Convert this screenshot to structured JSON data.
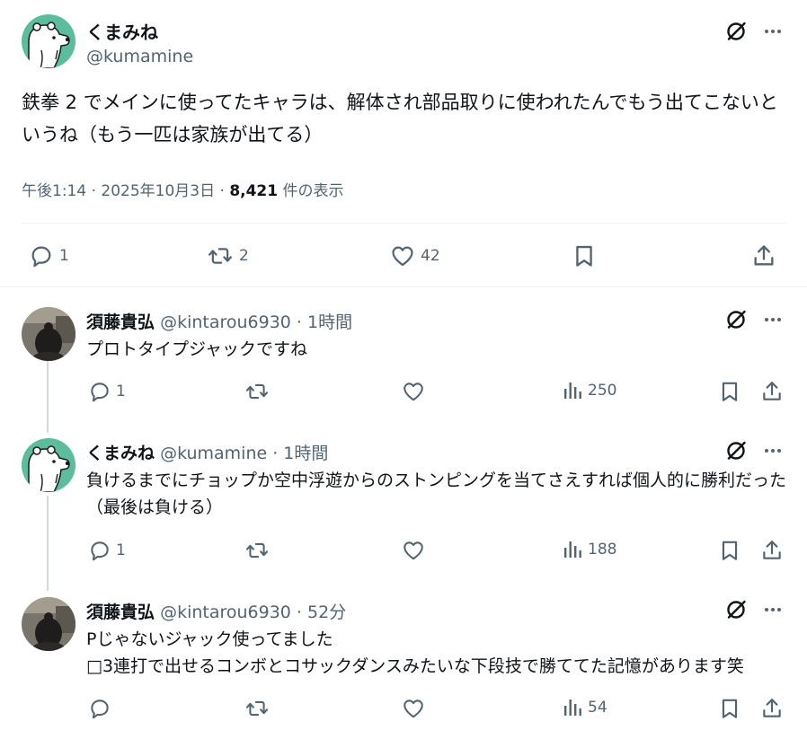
{
  "main_tweet": {
    "author_name": "くまみね",
    "author_handle": "@kumamine",
    "text_line1": "鉄拳 2 でメインに使ってたキャラは、解体され部品取りに使われたんでもう出てこないと",
    "text_line2": "いうね（もう一匹は家族が出てる）",
    "time": "午後1:14 · 2025年10月3日 · ",
    "views_count": "8,421",
    "views_label": " 件の表示",
    "reply_count": "1",
    "retweet_count": "2",
    "like_count": "42"
  },
  "replies": [
    {
      "author_name": "須藤貴弘",
      "author_handle": "@kintarou6930 · 1時間",
      "line1": "プロトタイプジャックですね",
      "line2": "",
      "reply_count": "1",
      "views": "250"
    },
    {
      "author_name": "くまみね",
      "author_handle": "@kumamine · 1時間",
      "line1": "負けるまでにチョップか空中浮遊からのストンピングを当てさえすれば個人的に勝利だった...",
      "line2": "（最後は負ける）",
      "reply_count": "1",
      "views": "188"
    },
    {
      "author_name": "須藤貴弘",
      "author_handle": "@kintarou6930 · 52分",
      "line1": "Pじゃないジャック使ってました",
      "line2": "□3連打で出せるコンボとコサックダンスみたいな下段技で勝ててた記憶があります笑",
      "reply_count": "",
      "views": "54"
    }
  ],
  "icons": {
    "grok": "grok-icon",
    "more": "more-icon",
    "reply": "reply-icon",
    "retweet": "retweet-icon",
    "like": "like-icon",
    "bookmark": "bookmark-icon",
    "share": "share-icon",
    "views": "views-icon"
  },
  "colors": {
    "text": "#0f1419",
    "secondary": "#536471",
    "divider": "#eff3f4",
    "thread_line": "#cfd9de",
    "avatar_bear_bg": "#5bbd9d"
  }
}
